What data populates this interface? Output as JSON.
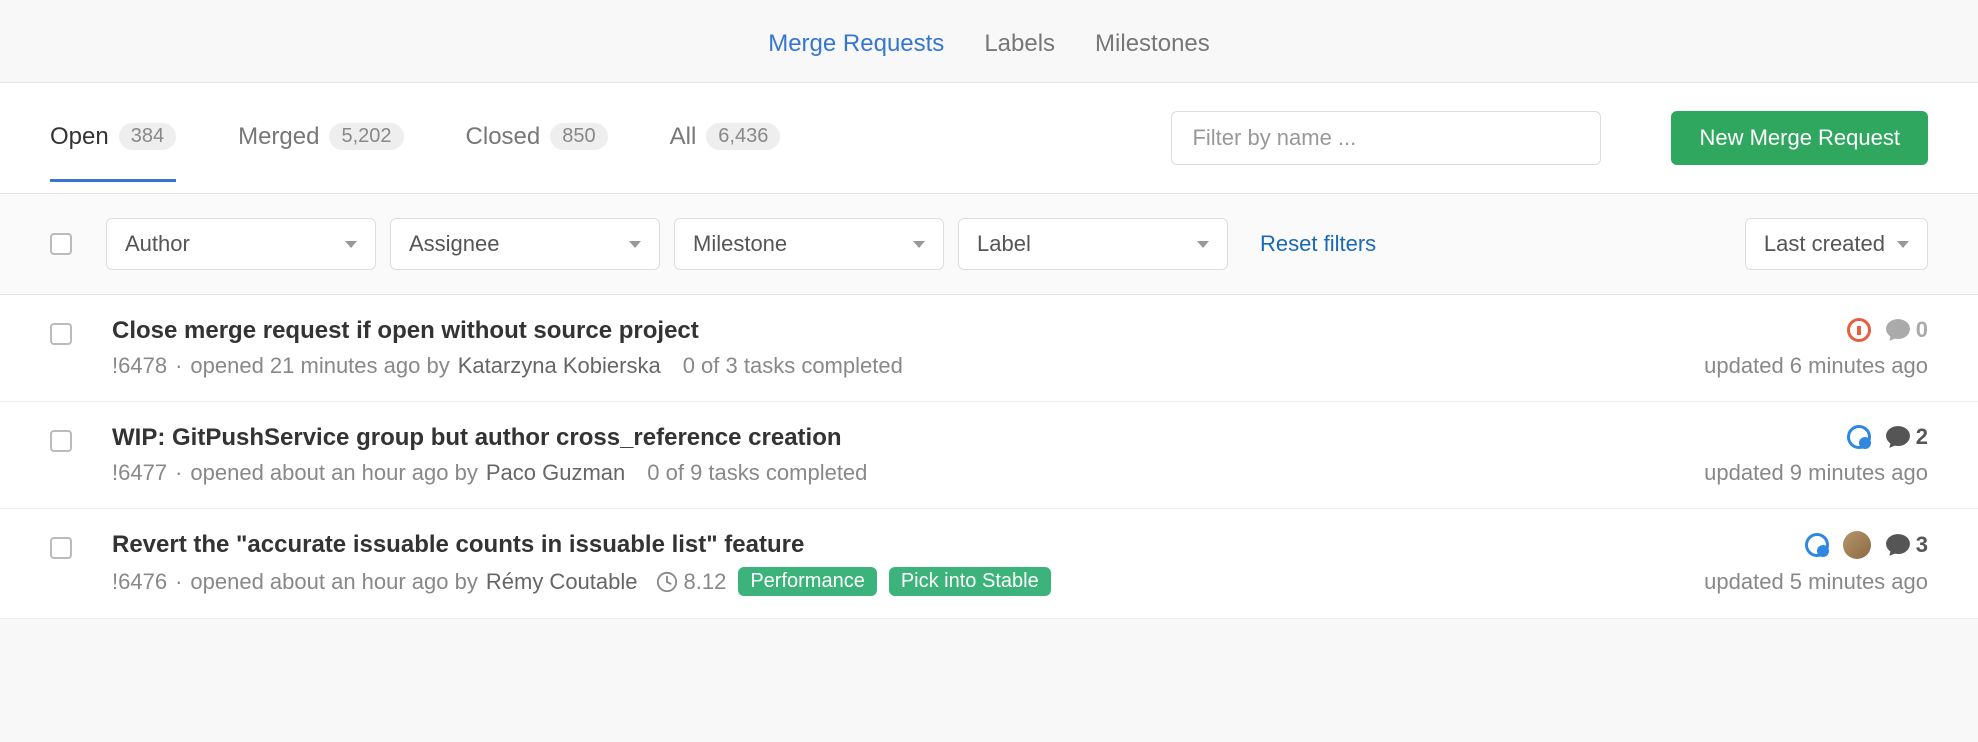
{
  "nav": {
    "items": [
      {
        "label": "Merge Requests",
        "active": true
      },
      {
        "label": "Labels",
        "active": false
      },
      {
        "label": "Milestones",
        "active": false
      }
    ]
  },
  "state_tabs": [
    {
      "label": "Open",
      "count": "384",
      "active": true
    },
    {
      "label": "Merged",
      "count": "5,202",
      "active": false
    },
    {
      "label": "Closed",
      "count": "850",
      "active": false
    },
    {
      "label": "All",
      "count": "6,436",
      "active": false
    }
  ],
  "filter_input": {
    "placeholder": "Filter by name ..."
  },
  "new_button": "New Merge Request",
  "filters": {
    "author": "Author",
    "assignee": "Assignee",
    "milestone": "Milestone",
    "label": "Label",
    "reset": "Reset filters",
    "sort": "Last created"
  },
  "rows": [
    {
      "title": "Close merge request if open without source project",
      "ref": "!6478",
      "opened": "opened 21 minutes ago by",
      "author": "Katarzyna Kobierska",
      "tasks": "0 of 3 tasks completed",
      "updated": "updated 6 minutes ago",
      "ci": "pending",
      "comments": "0",
      "comments_zero": true
    },
    {
      "title": "WIP: GitPushService group but author cross_reference creation",
      "ref": "!6477",
      "opened": "opened about an hour ago by",
      "author": "Paco Guzman",
      "tasks": "0 of 9 tasks completed",
      "updated": "updated 9 minutes ago",
      "ci": "running",
      "comments": "2",
      "comments_zero": false
    },
    {
      "title": "Revert the \"accurate issuable counts in issuable list\" feature",
      "ref": "!6476",
      "opened": "opened about an hour ago by",
      "author": "Rémy Coutable",
      "milestone": "8.12",
      "labels": [
        {
          "text": "Performance",
          "color": "#3cb37a"
        },
        {
          "text": "Pick into Stable",
          "color": "#3cb37a"
        }
      ],
      "updated": "updated 5 minutes ago",
      "ci": "running",
      "comments": "3",
      "comments_zero": false,
      "assignee": true
    }
  ]
}
